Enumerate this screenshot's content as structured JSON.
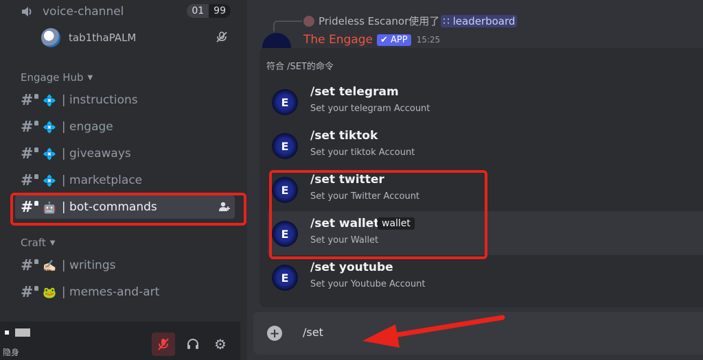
{
  "sidebar": {
    "voice_channel": {
      "name": "voice-channel",
      "count_current": "01",
      "count_limit": "99"
    },
    "voice_user": {
      "name": "tab1thaPALM"
    },
    "categories": [
      {
        "name": "Engage Hub"
      },
      {
        "name": "Craft"
      }
    ],
    "channels": [
      {
        "emoji": "💠",
        "name": "| instructions"
      },
      {
        "emoji": "💠",
        "name": "| engage"
      },
      {
        "emoji": "💠",
        "name": "| giveaways"
      },
      {
        "emoji": "💠",
        "name": "| marketplace"
      },
      {
        "emoji": "🤖",
        "name": "| bot-commands"
      },
      {
        "emoji": "✍🏻",
        "name": "| writings"
      },
      {
        "emoji": "🐸",
        "name": "| memes-and-art"
      }
    ],
    "panel": {
      "status": "隐身"
    }
  },
  "chat": {
    "reply": {
      "user": "Prideless Escanor",
      "action": "使用了",
      "command": "leaderboard"
    },
    "message": {
      "author": "The Engage",
      "badge": "✔ APP",
      "time": "15:25"
    }
  },
  "autocomplete": {
    "title": "符合 /SET的命令",
    "items": [
      {
        "command": "/set telegram",
        "description": "Set your telegram Account",
        "option": ""
      },
      {
        "command": "/set tiktok",
        "description": "Set your tiktok Account",
        "option": ""
      },
      {
        "command": "/set twitter",
        "description": "Set your Twitter Account",
        "option": ""
      },
      {
        "command": "/set wallet",
        "description": "Set your Wallet",
        "option": "wallet"
      },
      {
        "command": "/set youtube",
        "description": "Set your Youtube Account",
        "option": ""
      }
    ]
  },
  "input": {
    "value": "/set"
  },
  "colors": {
    "highlight": "#e8231a",
    "accent": "#5865f2",
    "author": "#f0543f"
  }
}
